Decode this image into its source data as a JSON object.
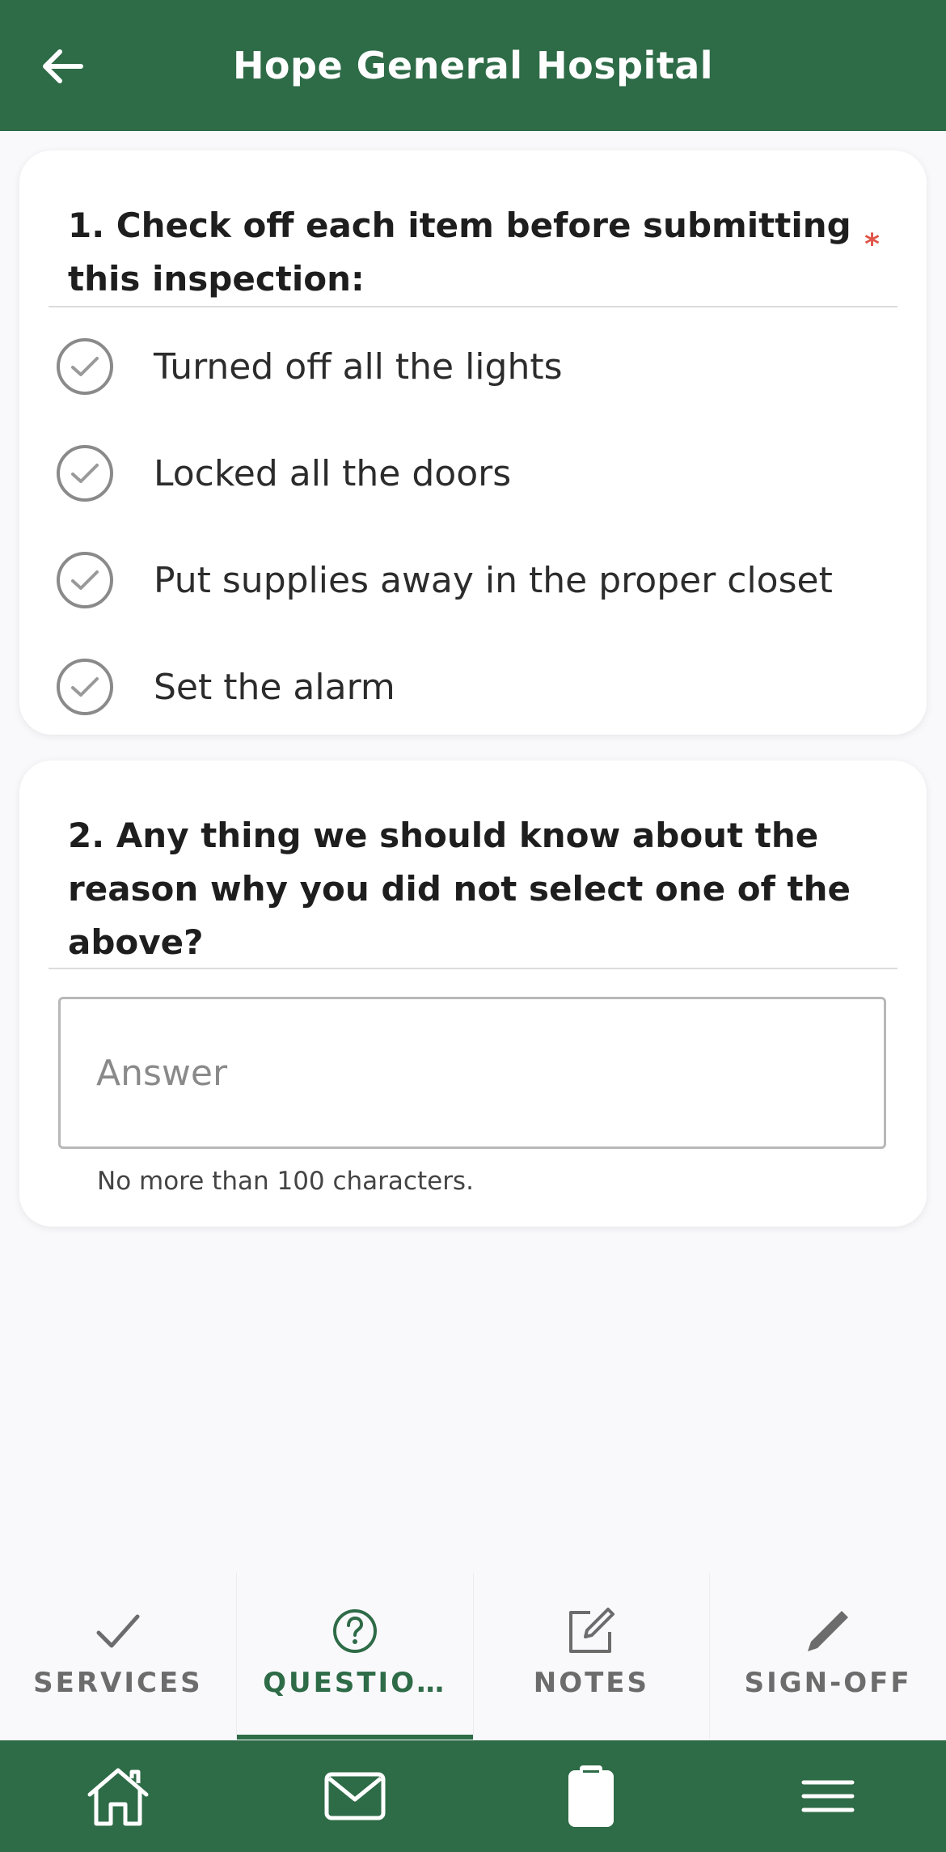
{
  "header": {
    "title": "Hope General Hospital"
  },
  "question1": {
    "title": "1. Check off each item before submitting this inspection:",
    "required_mark": "*",
    "items": [
      {
        "label": "Turned off all the lights"
      },
      {
        "label": "Locked all the doors"
      },
      {
        "label": "Put supplies away in the proper closet"
      },
      {
        "label": "Set the alarm"
      }
    ]
  },
  "question2": {
    "title": "2. Any thing we should know about the reason why you did not select one of the above?",
    "placeholder": "Answer",
    "hint": "No more than 100 characters."
  },
  "tabs": [
    {
      "label": "SERVICES",
      "icon": "check-icon"
    },
    {
      "label": "QUESTIO…",
      "icon": "question-circle-icon",
      "active": true
    },
    {
      "label": "NOTES",
      "icon": "edit-note-icon"
    },
    {
      "label": "SIGN-OFF",
      "icon": "pencil-icon"
    }
  ],
  "bottom_nav": [
    {
      "icon": "home-icon"
    },
    {
      "icon": "mail-icon"
    },
    {
      "icon": "clipboard-icon"
    },
    {
      "icon": "menu-icon"
    }
  ],
  "colors": {
    "brand": "#2e6b47",
    "required": "#e05548"
  }
}
